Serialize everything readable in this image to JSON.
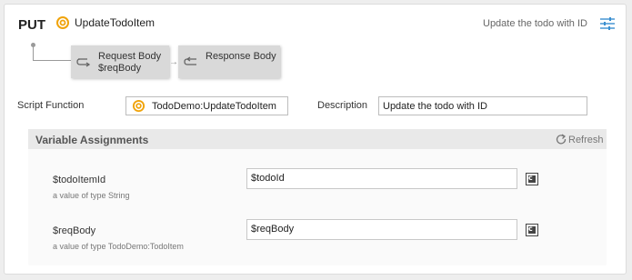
{
  "header": {
    "method": "PUT",
    "name": "UpdateTodoItem",
    "summary": "Update the todo with ID",
    "title_icon": "gear-icon",
    "settings_icon": "sliders-icon"
  },
  "flow": {
    "steps": [
      {
        "line1": "Request Body",
        "line2": "$reqBody",
        "icon": "request-flow-icon"
      },
      {
        "line1": "Response Body",
        "line2": "",
        "icon": "response-flow-icon"
      }
    ]
  },
  "script_function": {
    "label": "Script Function",
    "value": "TodoDemo:UpdateTodoItem",
    "icon": "gear-icon"
  },
  "description": {
    "label": "Description",
    "value": "Update the todo with ID"
  },
  "variable_assignments": {
    "title": "Variable Assignments",
    "refresh_label": "Refresh",
    "variables": [
      {
        "name": "$todoItemId",
        "type": "a value of type String",
        "value": "$todoId"
      },
      {
        "name": "$reqBody",
        "type": "a value of type TodoDemo:TodoItem",
        "value": "$reqBody"
      }
    ]
  },
  "colors": {
    "accent": "#f0a30a",
    "settings_icon": "#3a8fd0"
  }
}
